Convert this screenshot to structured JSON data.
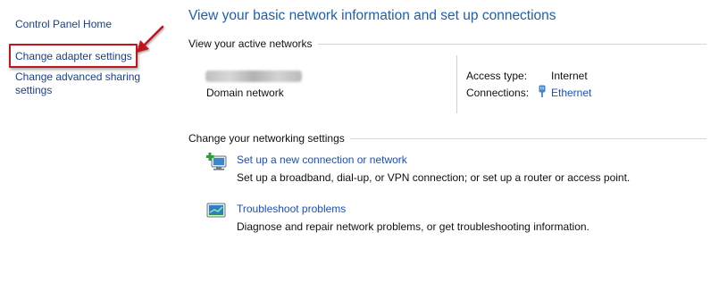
{
  "sidebar": {
    "home_label": "Control Panel Home",
    "adapter_label": "Change adapter settings",
    "sharing_label_line1": "Change advanced sharing",
    "sharing_label_line2": "settings"
  },
  "main": {
    "title": "View your basic network information and set up connections",
    "active_networks_header": "View your active networks",
    "network": {
      "category": "Domain network",
      "access_type_label": "Access type:",
      "access_type_value": "Internet",
      "connections_label": "Connections:",
      "connection_name": "Ethernet"
    },
    "settings_header": "Change your networking settings",
    "tasks": [
      {
        "icon": "new-connection-icon",
        "title": "Set up a new connection or network",
        "description": "Set up a broadband, dial-up, or VPN connection; or set up a router or access point."
      },
      {
        "icon": "troubleshoot-icon",
        "title": "Troubleshoot problems",
        "description": "Diagnose and repair network problems, or get troubleshooting information."
      }
    ]
  },
  "colors": {
    "link": "#1a4ec0",
    "title": "#1e5fb0",
    "annotation_red": "#c0171d"
  }
}
